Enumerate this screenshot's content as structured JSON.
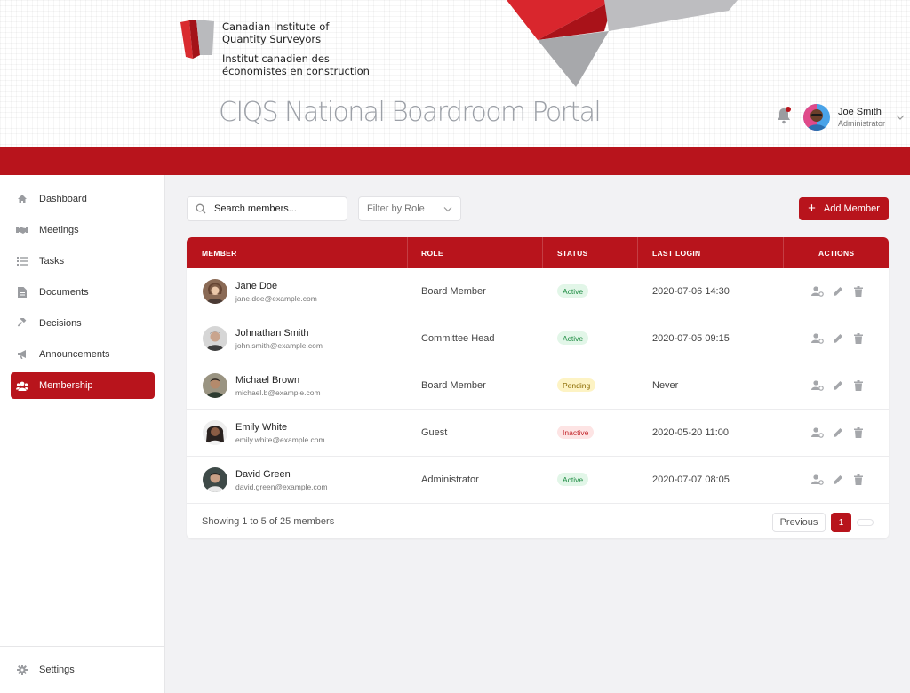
{
  "org": {
    "name_en_1": "Canadian Institute of",
    "name_en_2": "Quantity Surveyors",
    "name_fr_1": "Institut canadien des",
    "name_fr_2": "économistes en construction"
  },
  "portal_title": "CIQS National Boardroom Portal",
  "user": {
    "name": "Joe Smith",
    "role": "Administrator"
  },
  "colors": {
    "brand_red": "#b8141c",
    "sidebar_bg": "#ffffff",
    "page_bg": "#f2f2f4"
  },
  "sidebar": {
    "items": [
      {
        "label": "Dashboard",
        "icon": "home-icon"
      },
      {
        "label": "Meetings",
        "icon": "handshake-icon"
      },
      {
        "label": "Tasks",
        "icon": "list-icon"
      },
      {
        "label": "Documents",
        "icon": "document-icon"
      },
      {
        "label": "Decisions",
        "icon": "gavel-icon"
      },
      {
        "label": "Announcements",
        "icon": "megaphone-icon"
      },
      {
        "label": "Membership",
        "icon": "users-icon",
        "active": true
      }
    ],
    "settings": {
      "label": "Settings",
      "icon": "gear-icon"
    }
  },
  "toolbar": {
    "search_placeholder": "Search members...",
    "filter_label": "Filter by Role",
    "add_label": "Add Member",
    "add_icon": "+"
  },
  "table": {
    "columns": [
      "MEMBER",
      "ROLE",
      "STATUS",
      "LAST LOGIN",
      "ACTIONS"
    ],
    "rows": [
      {
        "name": "Jane Doe",
        "email": "jane.doe@example.com",
        "role": "Board Member",
        "status": "Active",
        "last_login": "2020-07-06 14:30"
      },
      {
        "name": "Johnathan Smith",
        "email": "john.smith@example.com",
        "role": "Committee Head",
        "status": "Active",
        "last_login": "2020-07-05 09:15"
      },
      {
        "name": "Michael Brown",
        "email": "michael.b@example.com",
        "role": "Board Member",
        "status": "Pending",
        "last_login": "Never"
      },
      {
        "name": "Emily White",
        "email": "emily.white@example.com",
        "role": "Guest",
        "status": "Inactive",
        "last_login": "2020-05-20 11:00"
      },
      {
        "name": "David Green",
        "email": "david.green@example.com",
        "role": "Administrator",
        "status": "Active",
        "last_login": "2020-07-07 08:05"
      }
    ],
    "actions": [
      "user-settings-icon",
      "pencil-icon",
      "trash-icon"
    ]
  },
  "pagination": {
    "summary": "Showing 1 to 5 of 25 members",
    "prev_label": "Previous",
    "current_page": "1"
  }
}
